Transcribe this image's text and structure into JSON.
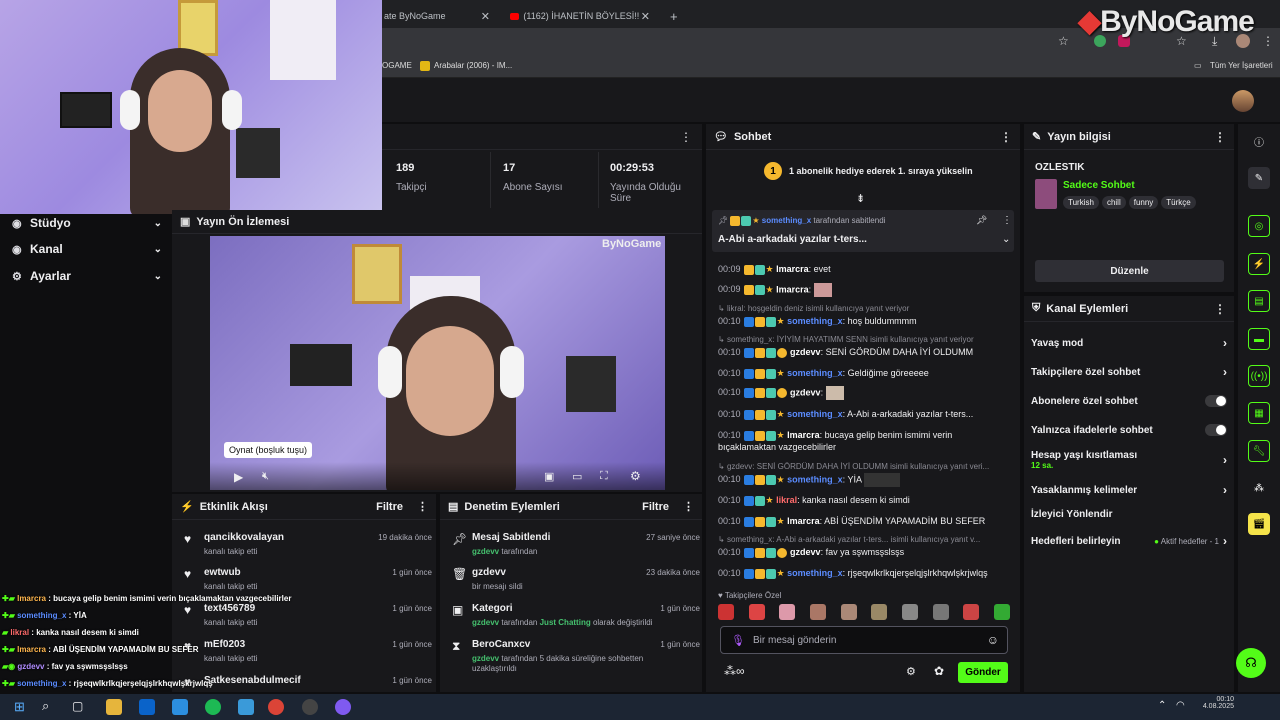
{
  "browser": {
    "tabs": [
      {
        "label": "ate ByNoGame"
      },
      {
        "label": "(1162) İHANETİN BÖYLESİ!! || S..."
      }
    ],
    "bookmarks": [
      {
        "label": "OGAME"
      },
      {
        "label": "Arabalar (2006) - IM..."
      }
    ],
    "bookmarks_right": "Tüm Yer İşaretleri"
  },
  "watermark": "ByNoGame",
  "preview_watermark": "ByNoGame",
  "sidebar": {
    "items": [
      {
        "label": "Stüdyo",
        "icon": "studio-icon"
      },
      {
        "label": "Kanal",
        "icon": "channel-icon"
      },
      {
        "label": "Ayarlar",
        "icon": "gear-icon"
      }
    ]
  },
  "stats": [
    {
      "value": "189",
      "label": "Takipçi"
    },
    {
      "value": "17",
      "label": "Abone Sayısı"
    },
    {
      "value": "00:29:53",
      "label": "Yayında Olduğu Süre"
    }
  ],
  "preview": {
    "title": "Yayın Ön İzlemesi",
    "tooltip": "Oynat (boşluk tuşu)"
  },
  "activity": {
    "title": "Etkinlik Akışı",
    "filter": "Filtre",
    "items": [
      {
        "name": "qancikkovalayan",
        "sub": "kanalı takip etti",
        "time": "19 dakika önce"
      },
      {
        "name": "ewtwub",
        "sub": "kanalı takip etti",
        "time": "1 gün önce"
      },
      {
        "name": "text456789",
        "sub": "kanalı takip etti",
        "time": "1 gün önce"
      },
      {
        "name": "mEf0203",
        "sub": "kanalı takip etti",
        "time": "1 gün önce"
      },
      {
        "name": "Satkesenabdulmecif",
        "sub": "",
        "time": "1 gün önce"
      }
    ]
  },
  "moderation": {
    "title": "Denetim Eylemleri",
    "filter": "Filtre",
    "items": [
      {
        "name": "Mesaj Sabitlendi",
        "user": "gzdevv",
        "sub": " tarafından",
        "extra": "",
        "extra2": "",
        "time": "27 saniye önce"
      },
      {
        "name": "gzdevv",
        "user": "",
        "sub": "bir mesajı sildi",
        "extra": "",
        "extra2": "",
        "time": "23 dakika önce"
      },
      {
        "name": "Kategori",
        "user": "gzdevv",
        "sub": " tarafından ",
        "extra": "Just Chatting",
        "extra2": " olarak değiştirildi",
        "time": "1 gün önce"
      },
      {
        "name": "BeroCanxcv",
        "user": "gzdevv",
        "sub": " tarafından 5 dakika süreliğine sohbetten uzaklaştırıldı",
        "extra": "",
        "extra2": "",
        "time": "1 gün önce"
      }
    ]
  },
  "chat": {
    "title": "Sohbet",
    "gift_banner_num": "1",
    "gift_banner": "1 abonelik hediye ederek 1. sıraya yükselin",
    "pinned_by_user": "something_x",
    "pinned_by": " tarafından sabitlendi",
    "pinned_msg": "A-Abi a-arkadaki yazılar t-ters...",
    "messages": [
      {
        "time": "00:09",
        "user": "lmarcra",
        "text": "evet",
        "color": "white"
      },
      {
        "time": "00:09",
        "user": "lmarcra",
        "text": "",
        "color": "white",
        "emote": true
      },
      {
        "reply": "likral: hoşgeldin deniz isimli kullanıcıya yanıt veriyor"
      },
      {
        "time": "00:10",
        "user": "something_x",
        "text": "hoş buldummmm",
        "color": "blue"
      },
      {
        "reply": "something_x: İYİYİM HAYATIMM SENN isimli kullanıcıya yanıt veriyor"
      },
      {
        "time": "00:10",
        "user": "gzdevv",
        "text": "SENİ GÖRDÜM DAHA İYİ OLDUMM",
        "color": "white"
      },
      {
        "time": "00:10",
        "user": "something_x",
        "text": "Geldiğime göreeeee",
        "color": "blue"
      },
      {
        "time": "00:10",
        "user": "gzdevv",
        "text": "",
        "color": "white",
        "emote": true
      },
      {
        "time": "00:10",
        "user": "something_x",
        "text": "A-Abi a-arkadaki yazılar t-ters...",
        "color": "blue"
      },
      {
        "time": "00:10",
        "user": "lmarcra",
        "text": "bucaya gelip benim ismimi verin bıçaklamaktan vazgecebilirler",
        "color": "white"
      },
      {
        "reply": "gzdevv: SENİ GÖRDÜM DAHA İYİ OLDUMM isimli kullanıcıya yanıt veri..."
      },
      {
        "time": "00:10",
        "user": "something_x",
        "text": "YİA",
        "color": "blue"
      },
      {
        "time": "00:10",
        "user": "likral",
        "text": "kanka nasıl desem ki simdi",
        "color": "red"
      },
      {
        "time": "00:10",
        "user": "lmarcra",
        "text": "ABİ ÜŞENDİM YAPAMADİM BU SEFER",
        "color": "white"
      },
      {
        "reply": "something_x: A-Abi a-arkadaki yazılar t-ters... isimli kullanıcıya yanıt v..."
      },
      {
        "time": "00:10",
        "user": "gzdevv",
        "text": "fav ya sşwmsşslsşs",
        "color": "white"
      },
      {
        "time": "00:10",
        "user": "something_x",
        "text": "rjşeqwlkrlkqjerşelqjşlrkhqwlşkrjwlqş",
        "color": "blue"
      }
    ],
    "emotes_label": "Takipçilere Özel",
    "input_placeholder": "Bir mesaj gönderin",
    "send": "Gönder"
  },
  "stream_info": {
    "title": "Yayın bilgisi",
    "streamer": "OZLESTIK",
    "category": "Sadece Sohbet",
    "tags": [
      "Turkish",
      "chill",
      "funny",
      "Türkçe"
    ],
    "edit": "Düzenle"
  },
  "channel_actions": {
    "title": "Kanal Eylemleri",
    "items": [
      {
        "label": "Yavaş mod",
        "kind": "chev"
      },
      {
        "label": "Takipçilere özel sohbet",
        "kind": "chev"
      },
      {
        "label": "Abonelere özel sohbet",
        "kind": "toggle"
      },
      {
        "label": "Yalnızca ifadelerle sohbet",
        "kind": "toggle"
      },
      {
        "label": "Hesap yaşı kısıtlaması",
        "kind": "chev",
        "sub": "12 sa."
      },
      {
        "label": "Yasaklanmış kelimeler",
        "kind": "chev"
      },
      {
        "label": "İzleyici Yönlendir",
        "kind": "none"
      },
      {
        "label": "Hedefleri belirleyin",
        "kind": "goal",
        "sub": "Aktif hedefler - 1"
      }
    ]
  },
  "overlay_chat": [
    {
      "user": "lmarcra",
      "text": " : bucaya gelip benim ismimi verin bıçaklamaktan vazgecebilirler",
      "color": "#ffb64d"
    },
    {
      "user": "something_x",
      "text": " : YİA",
      "color": "#5b8cff"
    },
    {
      "user": "likral",
      "text": " : kanka nasıl desem ki simdi",
      "color": "#ff6b6b"
    },
    {
      "user": "lmarcra",
      "text": " : ABİ ÜŞENDİM YAPAMADİM BU SEFER",
      "color": "#ffb64d"
    },
    {
      "user": "gzdevv",
      "text": " : fav ya sşwmsşslsşs",
      "color": "#b08cff"
    },
    {
      "user": "something_x",
      "text": " : rjşeqwlkrlkqjerşelqjşlrkhqwlşkrjwlqş",
      "color": "#5b8cff"
    }
  ],
  "clock": {
    "time": "00:10",
    "date": "4.08.2025"
  },
  "colors": {
    "accent": "#53fc18",
    "bg": "#0e0e10",
    "panel": "#18181b"
  }
}
